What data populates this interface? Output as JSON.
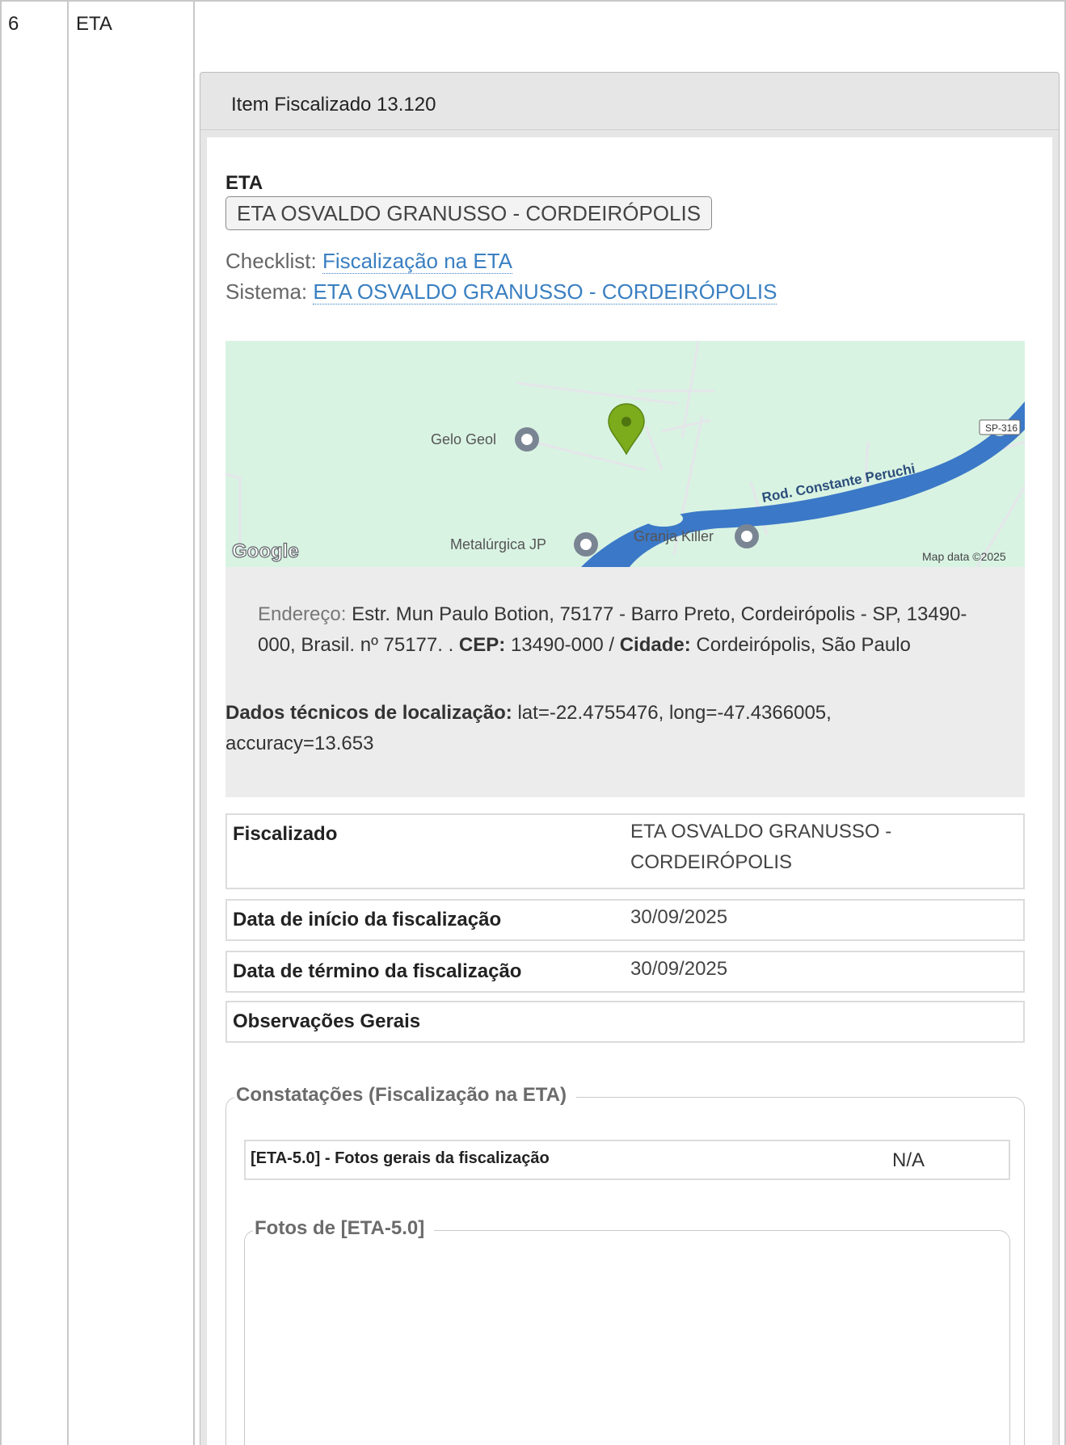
{
  "row": {
    "number": "6",
    "name": "ETA"
  },
  "card": {
    "header": "Item Fiscalizado 13.120",
    "eta_label": "ETA",
    "eta_tag": "ETA OSVALDO GRANUSSO - CORDEIRÓPOLIS",
    "checklist_label": "Checklist:",
    "checklist_link": "Fiscalização na ETA",
    "sistema_label": "Sistema:",
    "sistema_link": "ETA OSVALDO GRANUSSO - CORDEIRÓPOLIS"
  },
  "map": {
    "places": [
      "Gelo Geol",
      "Metalúrgica JP",
      "Granja Killer"
    ],
    "road": "Rod. Constante Peruchi",
    "shield": "SP-316",
    "brand": "Google",
    "attribution": "Map data ©2025",
    "colors": {
      "land": "#d9f3e3",
      "river": "#3b78c7",
      "marker": "#7cab1c"
    }
  },
  "location": {
    "endereco_label": "Endereço:",
    "endereco_text": "Estr. Mun Paulo Botion, 75177 - Barro Preto, Cordeirópolis - SP, 13490-000, Brasil. nº 75177. .",
    "cep_label": "CEP:",
    "cep_value": "13490-000 /",
    "cidade_label": "Cidade:",
    "cidade_value": "Cordeirópolis, São Paulo",
    "tech_label": "Dados técnicos de localização:",
    "tech_value": "lat=-22.4755476, long=-47.4366005, accuracy=13.653"
  },
  "details": [
    {
      "label": "Fiscalizado",
      "value": "ETA OSVALDO GRANUSSO - CORDEIRÓPOLIS"
    },
    {
      "label": "Data de início da fiscalização",
      "value": "30/09/2025"
    },
    {
      "label": "Data de término da fiscalização",
      "value": "30/09/2025"
    },
    {
      "label": "Observações Gerais",
      "value": ""
    }
  ],
  "constatacoes": {
    "legend": "Constatações (Fiscalização na ETA)",
    "item_label": "[ETA-5.0] - Fotos gerais da fiscalização",
    "item_value": "N/A",
    "fotos_legend": "Fotos de [ETA-5.0]"
  }
}
